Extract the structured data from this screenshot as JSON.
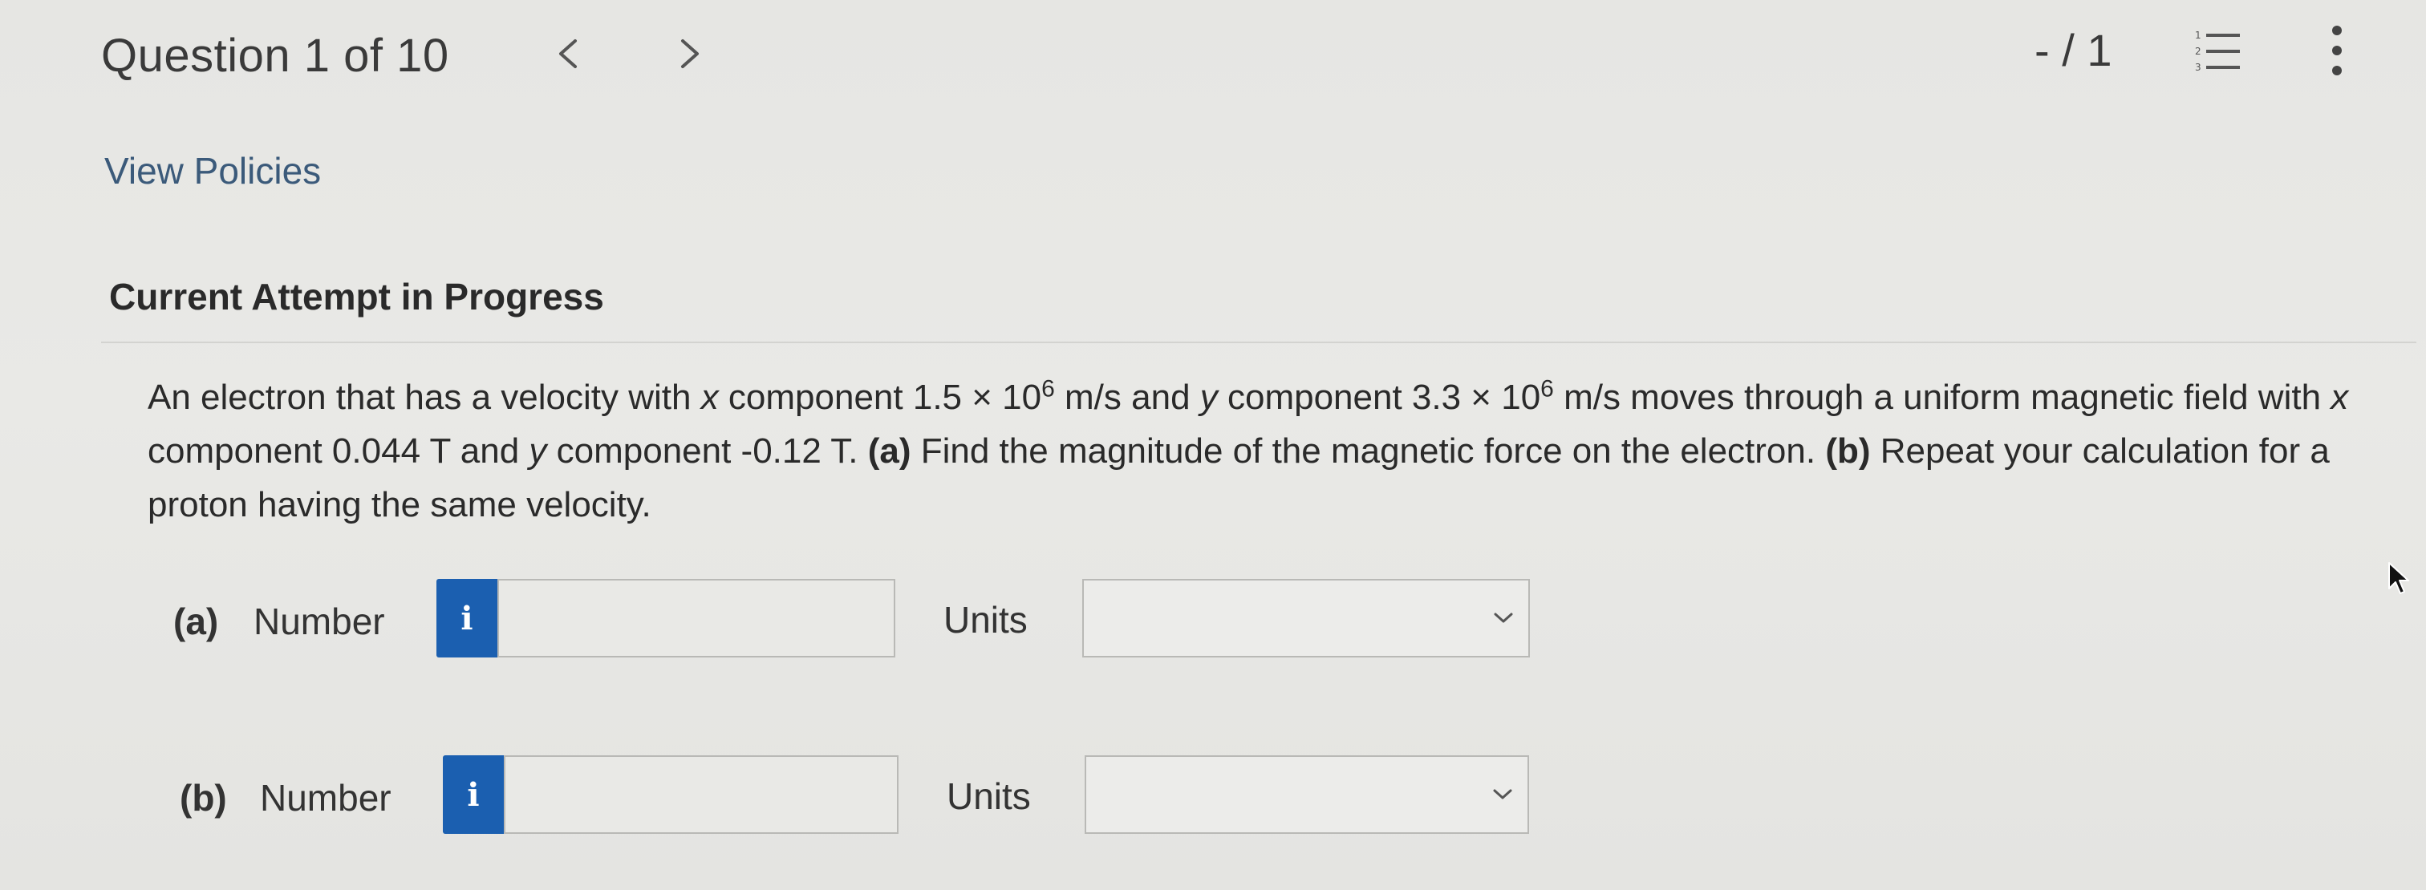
{
  "header": {
    "question_title": "Question 1 of 10",
    "prev_icon": "chevron-left-icon",
    "next_icon": "chevron-right-icon",
    "score": "- / 1",
    "list_icon": "numbered-list-icon",
    "more_icon": "vertical-ellipsis-icon"
  },
  "links": {
    "view_policies": "View Policies"
  },
  "attempt": {
    "title": "Current Attempt in Progress"
  },
  "question": {
    "p1": "An electron that has a velocity with ",
    "x1": "x",
    "p2": " component 1.5 × 10",
    "e1": "6",
    "p3": " m/s and ",
    "y1": "y",
    "p4": " component 3.3 × 10",
    "e2": "6",
    "p5": " m/s moves through a uniform magnetic field with ",
    "x2": "x",
    "p6": " component 0.044 T and ",
    "y2": "y",
    "p7": " component -0.12 T. ",
    "a_label": "(a)",
    "p8": " Find the magnitude of the magnetic force on the electron. ",
    "b_label": "(b)",
    "p9": " Repeat your calculation for a proton having the same velocity."
  },
  "answers": [
    {
      "part": "(a)",
      "number_label": "Number",
      "info_glyph": "i",
      "number_value": "",
      "units_label": "Units",
      "units_value": ""
    },
    {
      "part": "(b)",
      "number_label": "Number",
      "info_glyph": "i",
      "number_value": "",
      "units_label": "Units",
      "units_value": ""
    }
  ],
  "colors": {
    "info_button": "#1b5fb0",
    "link": "#3b5a7a",
    "background": "#e7e7e4"
  }
}
